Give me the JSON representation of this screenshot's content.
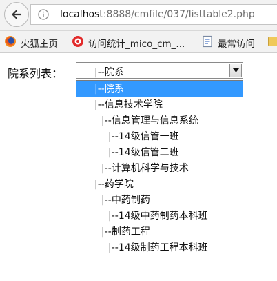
{
  "browser": {
    "url_host": "localhost",
    "url_path": ":8888/cmfile/037/listtable2.php"
  },
  "bookmarks": [
    {
      "label": "火狐主页",
      "icon": "firefox-icon"
    },
    {
      "label": "访问统计_mico_cm_...",
      "icon": "analytics-icon"
    },
    {
      "label": "最常访问",
      "icon": "document-icon"
    }
  ],
  "form": {
    "label": "院系列表：",
    "selected_value": "|--院系"
  },
  "dropdown": {
    "options": [
      "|--院系",
      "|--信息技术学院",
      "|--信息管理与信息系统",
      "|--14级信管一班",
      "|--14级信管二班",
      "|--计算机科学与技术",
      "|--药学院",
      "|--中药制药",
      "|--14级中药制药本科班",
      "|--制药工程",
      "|--14级制药工程本科班"
    ],
    "selected_index": 0,
    "selected_color": "#3399ff"
  }
}
